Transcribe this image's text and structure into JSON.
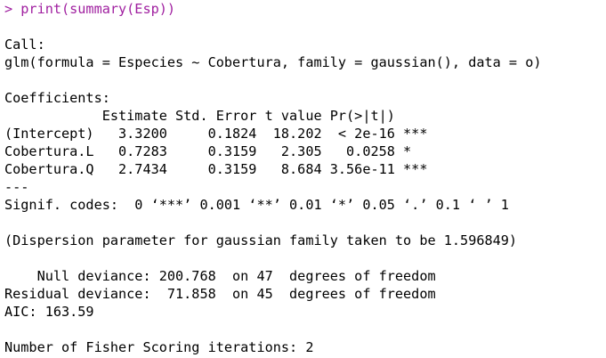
{
  "console": {
    "command": "> print(summary(Esp))",
    "lines": [
      "",
      "Call:",
      "glm(formula = Especies ~ Cobertura, family = gaussian(), data = o)",
      "",
      "Coefficients:",
      "            Estimate Std. Error t value Pr(>|t|)    ",
      "(Intercept)   3.3200     0.1824  18.202  < 2e-16 ***",
      "Cobertura.L   0.7283     0.3159   2.305   0.0258 *  ",
      "Cobertura.Q   2.7434     0.3159   8.684 3.56e-11 ***",
      "---",
      "Signif. codes:  0 ‘***’ 0.001 ‘**’ 0.01 ‘*’ 0.05 ‘.’ 0.1 ‘ ’ 1",
      "",
      "(Dispersion parameter for gaussian family taken to be 1.596849)",
      "",
      "    Null deviance: 200.768  on 47  degrees of freedom",
      "Residual deviance:  71.858  on 45  degrees of freedom",
      "AIC: 163.59",
      "",
      "Number of Fisher Scoring iterations: 2"
    ]
  },
  "colors": {
    "command": "#a020a0",
    "output": "#000000",
    "background": "#ffffff"
  }
}
